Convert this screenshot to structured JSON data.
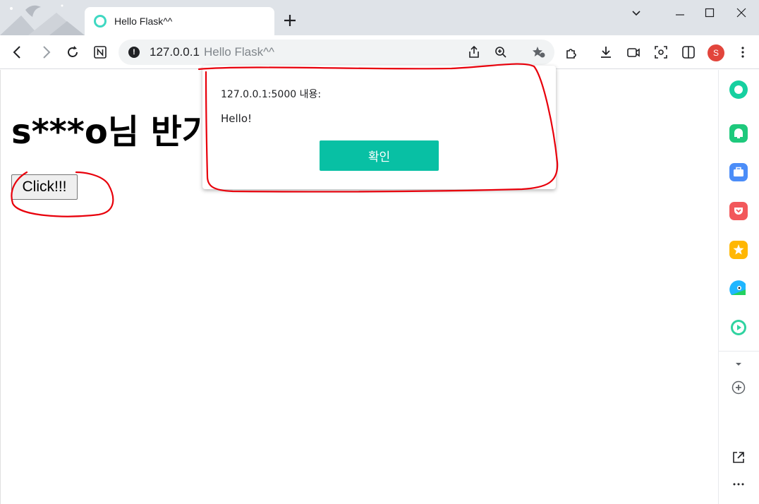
{
  "browser": {
    "tab": {
      "title": "Hello Flask^^"
    },
    "address": {
      "host": "127.0.0.1",
      "title": "Hello Flask^^"
    },
    "profile_initial": "S"
  },
  "page": {
    "greeting": "s***o님 반가",
    "button_label": "Click!!!"
  },
  "dialog": {
    "origin": "127.0.0.1:5000 내용:",
    "message": "Hello!",
    "ok_label": "확인"
  },
  "colors": {
    "accent": "#08c0a4",
    "annotation": "#e8000b"
  }
}
